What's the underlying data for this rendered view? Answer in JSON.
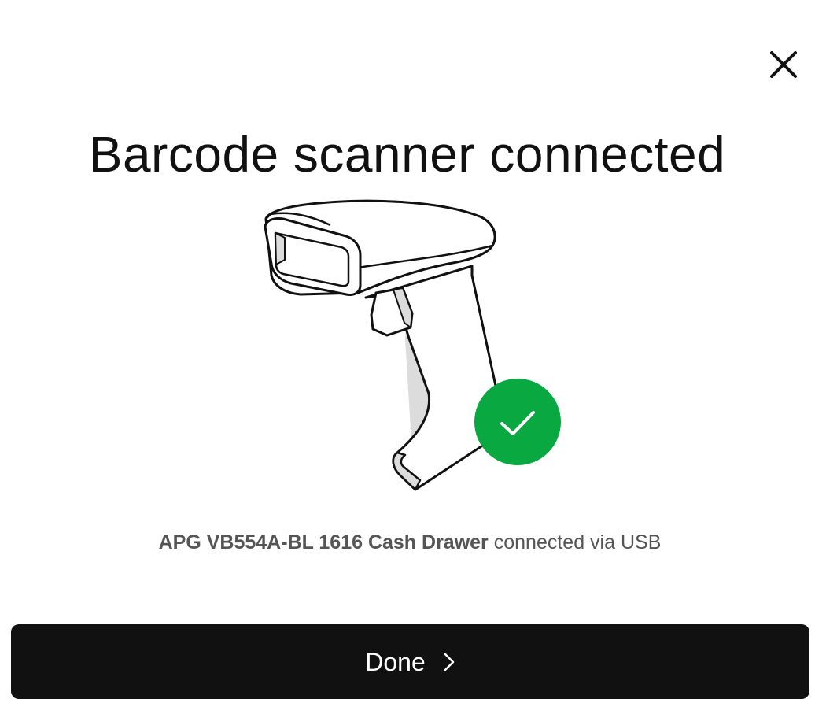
{
  "dialog": {
    "title": "Barcode scanner connected",
    "close_icon": "close-icon",
    "status": {
      "device_name": "APG VB554A-BL 1616 Cash Drawer",
      "suffix": " connected via USB"
    },
    "done_button": {
      "label": "Done",
      "icon": "chevron-right-icon"
    },
    "illustration": {
      "subject": "barcode-scanner",
      "badge_icon": "checkmark-icon"
    }
  },
  "colors": {
    "title_text": "#111111",
    "status_text": "#555555",
    "button_bg": "#111111",
    "button_text": "#ffffff",
    "success_badge": "#0aa841",
    "scanner_shadow": "#dcdcdc"
  }
}
